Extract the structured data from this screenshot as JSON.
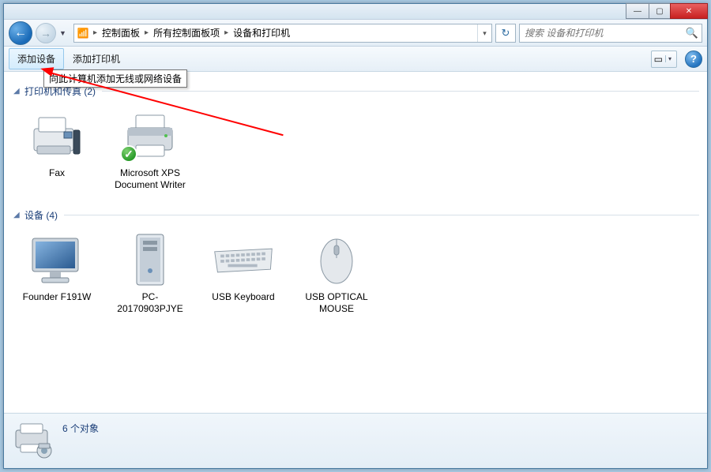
{
  "titlebar": {
    "minimize": "—",
    "maximize": "▢",
    "close": "✕"
  },
  "nav": {
    "back_glyph": "←",
    "fwd_glyph": "→",
    "drop_glyph": "▼"
  },
  "breadcrumb": {
    "root_icon": "📶",
    "items": [
      "控制面板",
      "所有控制面板项",
      "设备和打印机"
    ],
    "sep": "▸"
  },
  "addressbar": {
    "drop_glyph": "▾",
    "refresh_glyph": "↻"
  },
  "search": {
    "placeholder": "搜索 设备和打印机",
    "icon_glyph": "🔍"
  },
  "toolbar": {
    "add_device": "添加设备",
    "add_printer": "添加打印机",
    "tooltip": "向此计算机添加无线或网络设备",
    "view_glyph": "▭",
    "view_drop": "▾",
    "help_glyph": "?"
  },
  "groups": [
    {
      "title": "打印机和传真 (2)",
      "arrow": "◢",
      "items": [
        {
          "label": "Fax",
          "icon": "fax",
          "default": false
        },
        {
          "label": "Microsoft XPS Document Writer",
          "icon": "printer",
          "default": true
        }
      ]
    },
    {
      "title": "设备 (4)",
      "arrow": "◢",
      "items": [
        {
          "label": "Founder F191W",
          "icon": "monitor",
          "default": false
        },
        {
          "label": "PC-20170903PJYE",
          "icon": "tower",
          "default": false
        },
        {
          "label": "USB Keyboard",
          "icon": "keyboard",
          "default": false
        },
        {
          "label": "USB OPTICAL MOUSE",
          "icon": "mouse",
          "default": false
        }
      ]
    }
  ],
  "status": {
    "text": "6 个对象"
  },
  "colors": {
    "accent": "#2a6aa0",
    "link": "#1a3e78"
  }
}
